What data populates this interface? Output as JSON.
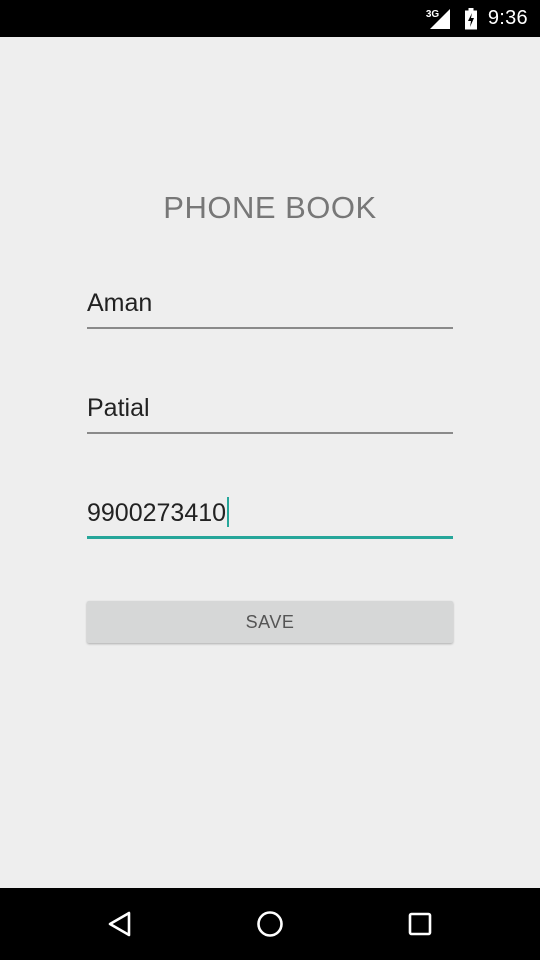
{
  "status_bar": {
    "network_type": "3G",
    "time": "9:36",
    "icons": [
      "signal-icon",
      "battery-charging-icon"
    ]
  },
  "app": {
    "title": "PHONE BOOK"
  },
  "form": {
    "first_name": "Aman",
    "last_name": "Patial",
    "phone": "9900273410",
    "focused_field": "phone",
    "save_label": "SAVE"
  },
  "nav_bar": {
    "icons": [
      "back-icon",
      "home-icon",
      "recents-icon"
    ]
  },
  "colors": {
    "background": "#eeeeee",
    "accent": "#26a69a",
    "title_text": "#777777",
    "button_bg": "#d6d7d7"
  }
}
